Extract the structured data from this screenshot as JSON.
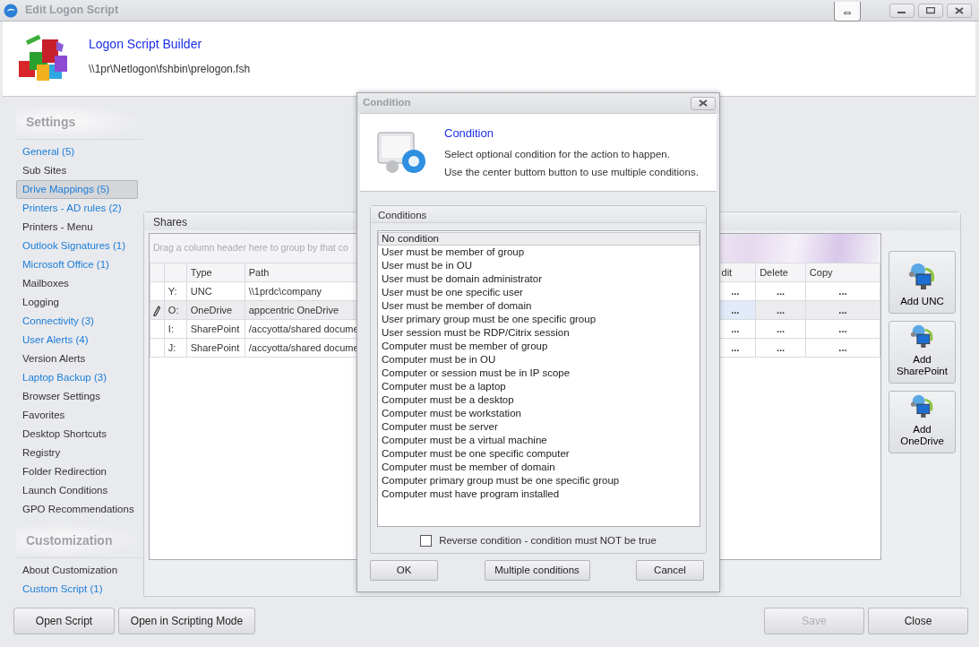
{
  "window": {
    "title": "Edit Logon Script",
    "resize_button": "⇔"
  },
  "header": {
    "title": "Logon Script Builder",
    "path": "\\\\1pr\\Netlogon\\fshbin\\prelogon.fsh"
  },
  "sidebar": {
    "sections": [
      {
        "heading": "Settings",
        "items": [
          {
            "label": "General (5)",
            "color": "#1a7dd7",
            "selected": false
          },
          {
            "label": "Sub Sites",
            "color": "#333333",
            "selected": false
          },
          {
            "label": "Drive Mappings (5)",
            "color": "#1a7dd7",
            "selected": true
          },
          {
            "label": "Printers - AD rules (2)",
            "color": "#1a7dd7",
            "selected": false
          },
          {
            "label": "Printers - Menu",
            "color": "#333333",
            "selected": false
          },
          {
            "label": "Outlook Signatures (1)",
            "color": "#1a7dd7",
            "selected": false
          },
          {
            "label": "Microsoft Office (1)",
            "color": "#1a7dd7",
            "selected": false
          },
          {
            "label": "Mailboxes",
            "color": "#333333",
            "selected": false
          },
          {
            "label": "Logging",
            "color": "#333333",
            "selected": false
          },
          {
            "label": "Connectivity (3)",
            "color": "#1a7dd7",
            "selected": false
          },
          {
            "label": "User Alerts (4)",
            "color": "#1a7dd7",
            "selected": false
          },
          {
            "label": "Version Alerts",
            "color": "#333333",
            "selected": false
          },
          {
            "label": "Laptop Backup (3)",
            "color": "#1a7dd7",
            "selected": false
          },
          {
            "label": "Browser Settings",
            "color": "#333333",
            "selected": false
          },
          {
            "label": "Favorites",
            "color": "#333333",
            "selected": false
          },
          {
            "label": "Desktop Shortcuts",
            "color": "#333333",
            "selected": false
          },
          {
            "label": "Registry",
            "color": "#333333",
            "selected": false
          },
          {
            "label": "Folder Redirection",
            "color": "#333333",
            "selected": false
          },
          {
            "label": "Launch Conditions",
            "color": "#333333",
            "selected": false
          },
          {
            "label": "GPO Recommendations",
            "color": "#333333",
            "selected": false
          }
        ]
      },
      {
        "heading": "Customization",
        "items": [
          {
            "label": "About Customization",
            "color": "#333333",
            "selected": false
          },
          {
            "label": "Custom Script (1)",
            "color": "#1a7dd7",
            "selected": false
          }
        ]
      }
    ]
  },
  "shares": {
    "title": "Shares",
    "group_panel": "Drag a column header here to group by that co",
    "columns": {
      "type": "Type",
      "path": "Path",
      "edit": "dit",
      "delete": "Delete",
      "copy": "Copy"
    },
    "rows": [
      {
        "drive": "Y:",
        "type": "UNC",
        "path": "\\\\1prdc\\company",
        "edit": "...",
        "delete": "...",
        "copy": "...",
        "selected": false
      },
      {
        "drive": "O:",
        "type": "OneDrive",
        "path": "appcentric OneDrive",
        "edit": "...",
        "delete": "...",
        "copy": "...",
        "selected": true
      },
      {
        "drive": "I:",
        "type": "SharePoint",
        "path": "/accyotta/shared docume",
        "edit": "...",
        "delete": "...",
        "copy": "...",
        "selected": false
      },
      {
        "drive": "J:",
        "type": "SharePoint",
        "path": "/accyotta/shared docume",
        "edit": "...",
        "delete": "...",
        "copy": "...",
        "selected": false
      }
    ],
    "side_buttons": [
      "Add UNC",
      "Add SharePoint",
      "Add OneDrive"
    ]
  },
  "footer": {
    "left": [
      {
        "label": "Open Script",
        "disabled": false
      },
      {
        "label": "Open in Scripting Mode",
        "disabled": false
      }
    ],
    "right": [
      {
        "label": "Save",
        "disabled": true
      },
      {
        "label": "Close",
        "disabled": false
      }
    ]
  },
  "dialog": {
    "title": "Condition",
    "heading": "Condition",
    "lines": [
      "Select optional condition for the action to happen.",
      "Use the center buttom button to use multiple conditions."
    ],
    "group_title": "Conditions",
    "conditions": [
      {
        "label": "No condition",
        "selected": true
      },
      {
        "label": "User must be member of group",
        "selected": false
      },
      {
        "label": "User must be in OU",
        "selected": false
      },
      {
        "label": "User must be domain administrator",
        "selected": false
      },
      {
        "label": "User must be one specific user",
        "selected": false
      },
      {
        "label": "User must be member of domain",
        "selected": false
      },
      {
        "label": "User primary group must be one specific group",
        "selected": false
      },
      {
        "label": "User session must be RDP/Citrix session",
        "selected": false
      },
      {
        "label": "Computer must be member of group",
        "selected": false
      },
      {
        "label": "Computer must be in OU",
        "selected": false
      },
      {
        "label": "Computer or session must be in IP scope",
        "selected": false
      },
      {
        "label": "Computer must be a laptop",
        "selected": false
      },
      {
        "label": "Computer must be a desktop",
        "selected": false
      },
      {
        "label": "Computer must be workstation",
        "selected": false
      },
      {
        "label": "Computer must be server",
        "selected": false
      },
      {
        "label": "Computer must be a virtual machine",
        "selected": false
      },
      {
        "label": "Computer must be one specific computer",
        "selected": false
      },
      {
        "label": "Computer must be member of domain",
        "selected": false
      },
      {
        "label": "Computer primary group must be one specific group",
        "selected": false
      },
      {
        "label": "Computer must have program installed",
        "selected": false
      }
    ],
    "reverse": {
      "label": "Reverse condition - condition must NOT be true",
      "checked": false
    },
    "buttons": [
      "OK",
      "Multiple conditions",
      "Cancel"
    ]
  }
}
